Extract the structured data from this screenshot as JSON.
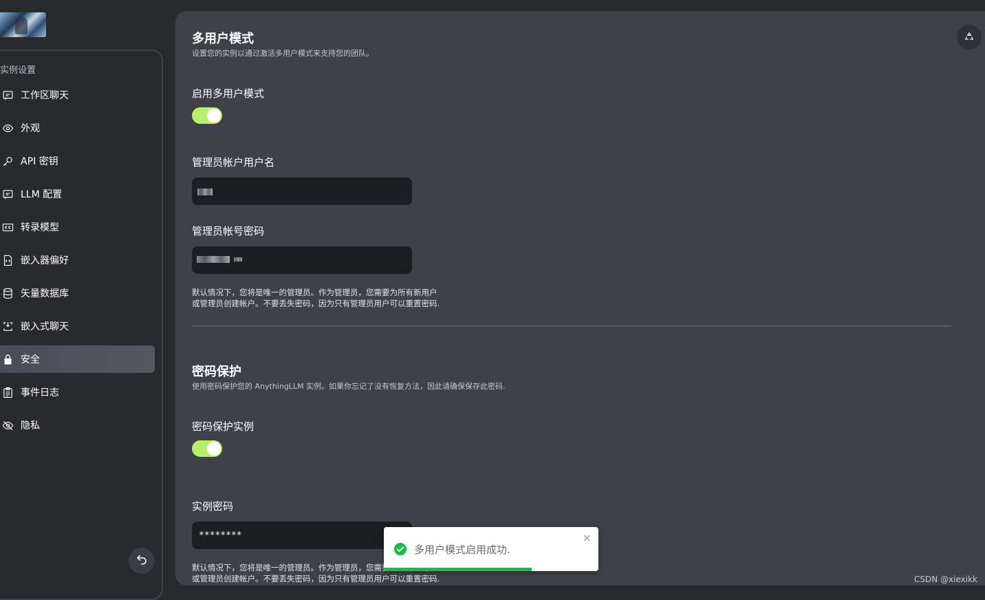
{
  "sidebar": {
    "section_title": "实例设置",
    "items": [
      {
        "label": "工作区聊天",
        "icon": "chat-icon"
      },
      {
        "label": "外观",
        "icon": "eye-icon"
      },
      {
        "label": "API 密钥",
        "icon": "key-icon"
      },
      {
        "label": "LLM 配置",
        "icon": "chat-icon"
      },
      {
        "label": "转录模型",
        "icon": "cc-icon"
      },
      {
        "label": "嵌入器偏好",
        "icon": "file-code-icon"
      },
      {
        "label": "矢量数据库",
        "icon": "database-icon"
      },
      {
        "label": "嵌入式聊天",
        "icon": "embed-icon"
      },
      {
        "label": "安全",
        "icon": "lock-icon",
        "active": true
      },
      {
        "label": "事件日志",
        "icon": "clipboard-icon"
      },
      {
        "label": "隐私",
        "icon": "eye-slash-icon"
      }
    ]
  },
  "multi_user": {
    "title": "多用户模式",
    "description": "设置您的实例以通过激活多用户模式来支持您的团队。",
    "enable_label": "启用多用户模式",
    "enabled": true,
    "username_label": "管理员帐户用户名",
    "username_value": "",
    "password_label": "管理员帐号密码",
    "password_value": "",
    "note_line1": "默认情况下，您将是唯一的管理员。作为管理员，您需要为所有新用户",
    "note_line2": "或管理员创建帐户。不要丢失密码，因为只有管理员用户可以重置密码."
  },
  "password_protection": {
    "title": "密码保护",
    "description": "使用密码保护您的 AnythingLLM 实例。如果你忘记了没有恢复方法，因此请确保保存此密码.",
    "protect_label": "密码保护实例",
    "enabled": true,
    "instance_password_label": "实例密码",
    "instance_password_value": "********",
    "note_line1": "默认情况下，您将是唯一的管理员。作为管理员，您需要为所有新用户",
    "note_line2": "或管理员创建帐户。不要丢失密码，因为只有管理员用户可以重置密码."
  },
  "toast": {
    "message": "多用户模式启用成功.",
    "close_symbol": "×",
    "progress": 0.69
  },
  "watermark": "CSDN @xiexikk",
  "colors": {
    "toggle_on": "#b8ef6a",
    "toast_success": "#1bbd4b",
    "panel_bg": "#3f4148",
    "page_bg": "#292a2e"
  }
}
